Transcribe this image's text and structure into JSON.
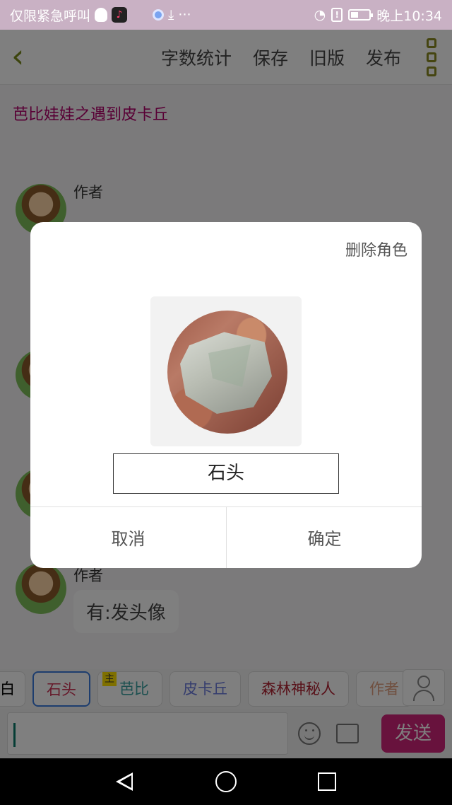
{
  "status_bar": {
    "carrier": "仅限紧急呼叫",
    "time": "晚上10:34"
  },
  "toolbar": {
    "actions": [
      "字数统计",
      "保存",
      "旧版",
      "发布"
    ]
  },
  "document": {
    "title": "芭比娃娃之遇到皮卡丘"
  },
  "messages": [
    {
      "author": "作者",
      "text": ""
    },
    {
      "author": "作者",
      "text": "有:发头像"
    }
  ],
  "character_bar": {
    "chips": [
      {
        "label": "白",
        "color": "#555555"
      },
      {
        "label": "石头",
        "color": "#cc3355",
        "selected": true
      },
      {
        "label": "芭比",
        "color": "#3aa0a0",
        "tag": "主"
      },
      {
        "label": "皮卡丘",
        "color": "#6a7adc"
      },
      {
        "label": "森林神秘人",
        "color": "#b02030"
      },
      {
        "label": "作者",
        "color": "#e0a080"
      }
    ]
  },
  "input_bar": {
    "send_label": "发送"
  },
  "dialog": {
    "delete_label": "删除角色",
    "name_value": "石头",
    "cancel_label": "取消",
    "confirm_label": "确定"
  }
}
